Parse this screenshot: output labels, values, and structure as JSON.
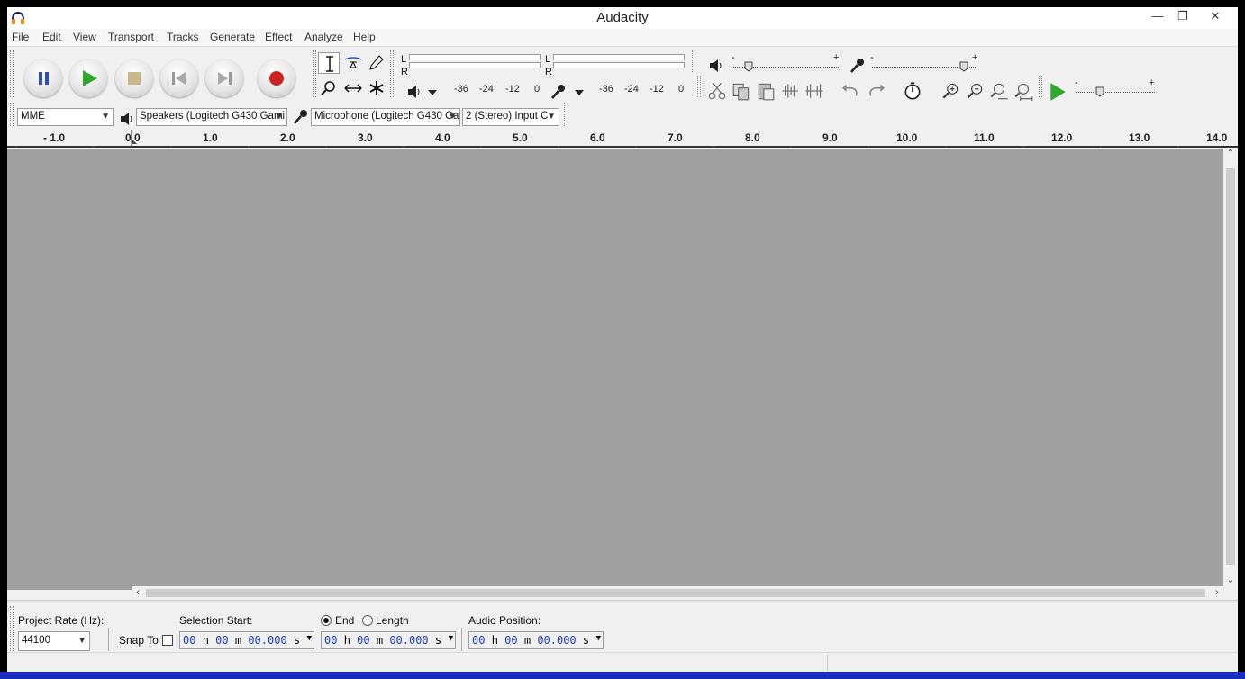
{
  "window": {
    "title": "Audacity"
  },
  "menubar": {
    "items": [
      "File",
      "Edit",
      "View",
      "Transport",
      "Tracks",
      "Generate",
      "Effect",
      "Analyze",
      "Help"
    ]
  },
  "transport": {
    "buttons": [
      {
        "name": "pause-button",
        "icon": "pause-icon"
      },
      {
        "name": "play-button",
        "icon": "play-icon"
      },
      {
        "name": "stop-button",
        "icon": "stop-icon"
      },
      {
        "name": "skip-to-start-button",
        "icon": "skip-start-icon"
      },
      {
        "name": "skip-to-end-button",
        "icon": "skip-end-icon"
      },
      {
        "name": "record-button",
        "icon": "record-icon"
      }
    ]
  },
  "meters": {
    "play_channels": [
      "L",
      "R"
    ],
    "record_channels": [
      "L",
      "R"
    ],
    "scale": [
      "-36",
      "-24",
      "-12",
      "0"
    ]
  },
  "mixer": {
    "output_minus": "-",
    "output_plus": "+",
    "input_minus": "-",
    "input_plus": "+"
  },
  "playatspeed": {
    "minus": "-",
    "plus": "+"
  },
  "devices": {
    "host": "MME",
    "playback": "Speakers (Logitech G430 Gami",
    "recording": "Microphone (Logitech G430 Ga",
    "channels": "2 (Stereo) Input C"
  },
  "ruler": {
    "ticks": [
      "- 1.0",
      "0.0",
      "1.0",
      "2.0",
      "3.0",
      "4.0",
      "5.0",
      "6.0",
      "7.0",
      "8.0",
      "9.0",
      "10.0",
      "11.0",
      "12.0",
      "13.0",
      "14.0"
    ]
  },
  "selection": {
    "project_rate_label": "Project Rate (Hz):",
    "project_rate_value": "44100",
    "snap_to_label": "Snap To",
    "selection_start_label": "Selection Start:",
    "end_label": "End",
    "length_label": "Length",
    "audio_position_label": "Audio Position:",
    "time_hh": "00",
    "time_h": "h",
    "time_mm": "00",
    "time_m": "m",
    "time_ss": "00.000",
    "time_s": "s"
  },
  "colors": {
    "track_area": "#a0a0a0",
    "time_digits": "#1f3fbf",
    "play_green": "#2fa82f",
    "record_red": "#cc2222"
  }
}
